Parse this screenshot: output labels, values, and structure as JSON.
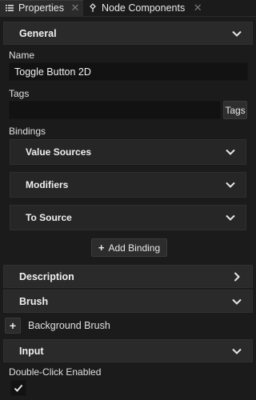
{
  "tabs": [
    {
      "label": "Properties",
      "icon": "list-icon",
      "active": true
    },
    {
      "label": "Node Components",
      "icon": "component-icon",
      "active": false
    }
  ],
  "sections": {
    "general": "General",
    "description": "Description",
    "brush": "Brush",
    "input": "Input"
  },
  "fields": {
    "name_label": "Name",
    "name_value": "Toggle Button 2D",
    "tags_label": "Tags",
    "tags_value": "",
    "tags_button": "Tags",
    "bindings_label": "Bindings"
  },
  "bindings": {
    "value_sources": "Value Sources",
    "modifiers": "Modifiers",
    "to_source": "To Source",
    "add_binding": "Add Binding"
  },
  "brush": {
    "background_brush": "Background Brush"
  },
  "input": {
    "double_click_label": "Double-Click Enabled",
    "double_click_checked": true
  },
  "colors": {
    "background": "#1b1b1b",
    "header": "#2a2a2a",
    "field": "#121212"
  }
}
